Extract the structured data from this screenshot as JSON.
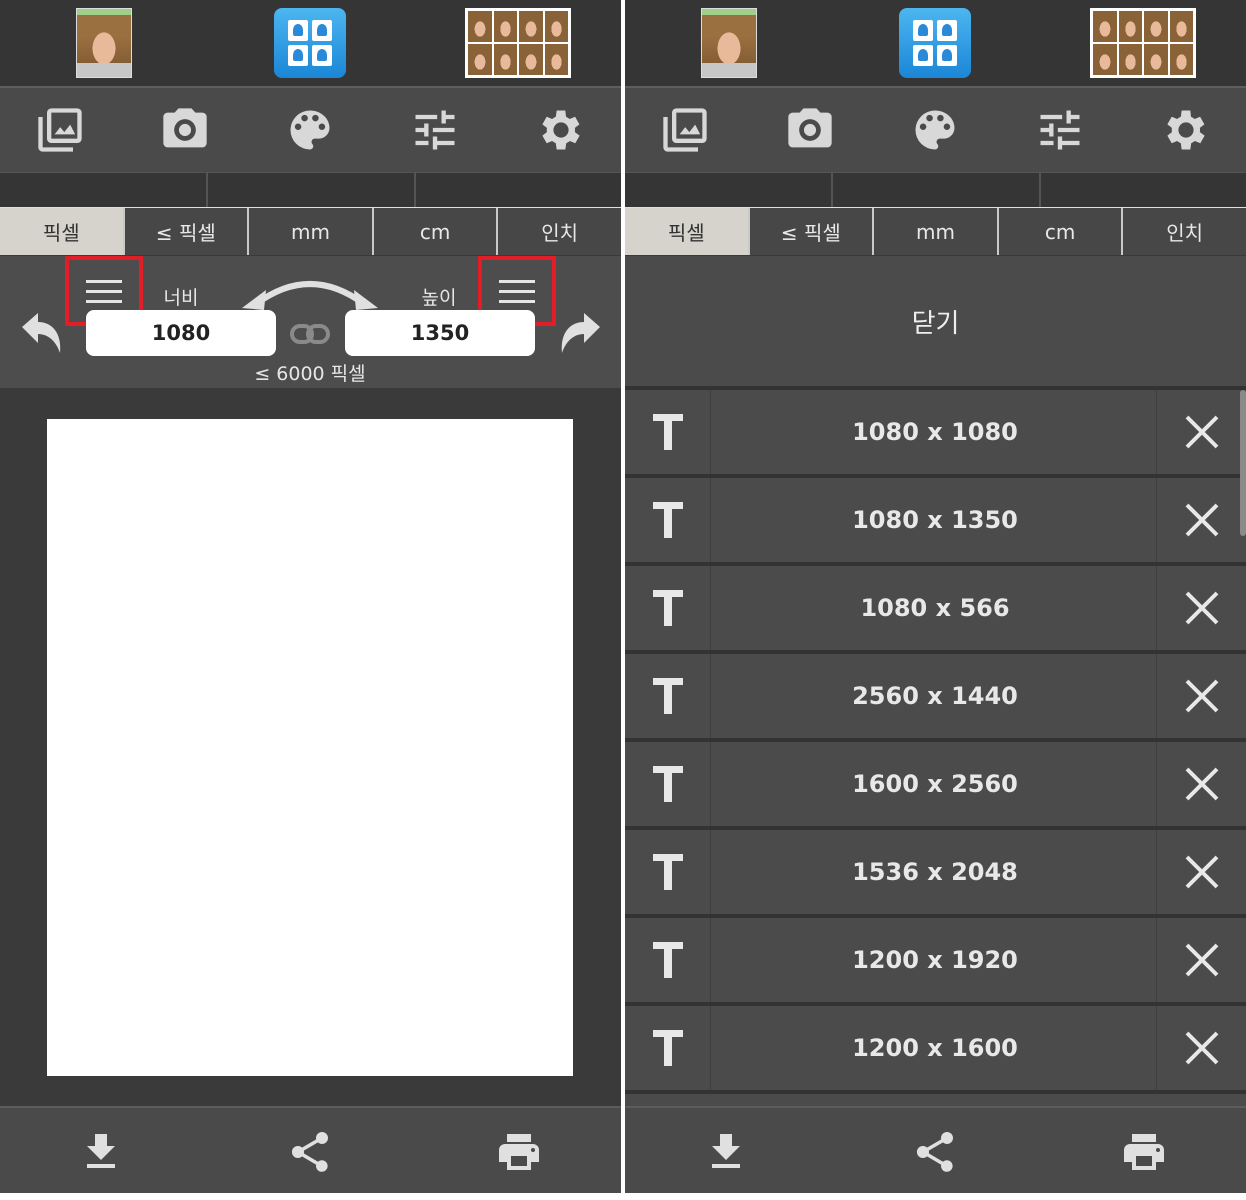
{
  "left": {
    "units": [
      "픽셀",
      "≤ 픽셀",
      "mm",
      "cm",
      "인치"
    ],
    "active_unit": "픽셀",
    "width_label": "너비",
    "height_label": "높이",
    "width_value": "1080",
    "height_value": "1350",
    "limit_text": "≤ 6000 픽셀"
  },
  "right": {
    "units": [
      "픽셀",
      "≤ 픽셀",
      "mm",
      "cm",
      "인치"
    ],
    "active_unit": "픽셀",
    "close_label": "닫기",
    "presets": [
      "1080 x 1080",
      "1080 x 1350",
      "1080 x 566",
      "2560 x 1440",
      "1600 x 2560",
      "1536 x 2048",
      "1200 x 1920",
      "1200 x 1600"
    ]
  },
  "colors": {
    "highlight": "#e11e27",
    "active_tab": "#d6d3cd",
    "app_icon": "#2a8ad8"
  },
  "icons": {
    "toolbar": [
      "gallery-icon",
      "camera-icon",
      "palette-icon",
      "sliders-icon",
      "gear-icon"
    ],
    "bottom": [
      "download-icon",
      "share-icon",
      "print-icon"
    ]
  }
}
